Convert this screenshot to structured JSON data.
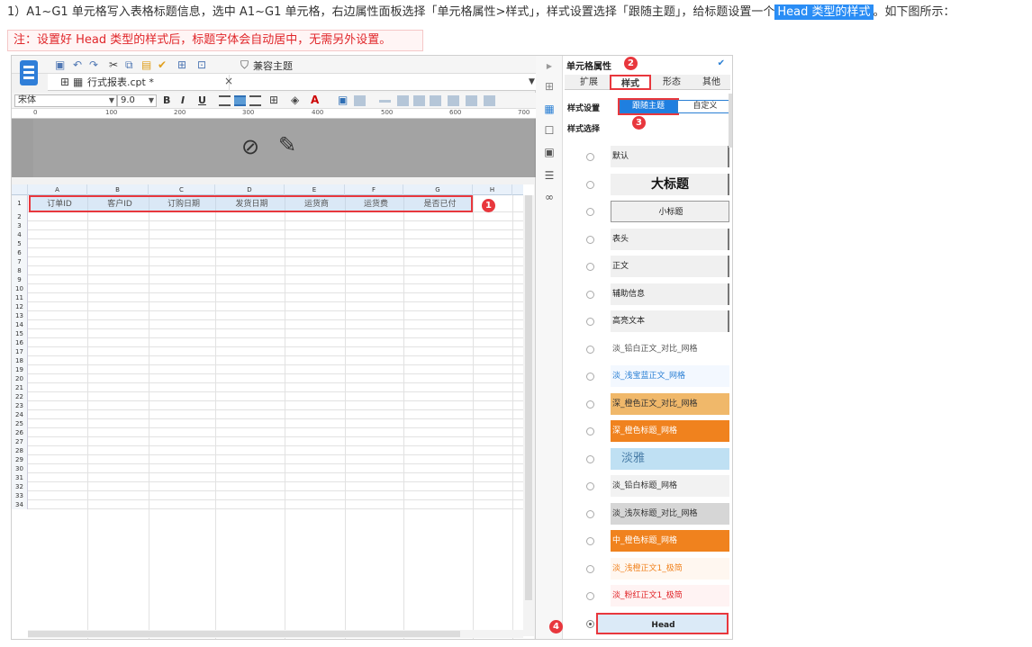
{
  "intro": {
    "text_before": "1）A1~G1 单元格写入表格标题信息，选中 A1~G1 单元格，右边属性面板选择「单元格属性>样式」，样式设置选择「跟随主题」，给标题设置一个",
    "highlight": "Head 类型的样式",
    "text_after": "。如下图所示："
  },
  "note": "注：设置好 Head 类型的样式后，标题字体会自动居中，无需另外设置。",
  "toolbar": {
    "compat_label": "兼容主题",
    "tab_label": "行式报表.cpt *",
    "tab_close": "×",
    "font_name": "宋体",
    "font_size": "9.0",
    "bold": "B",
    "italic": "I",
    "underline": "U"
  },
  "ruler": [
    "0",
    "100",
    "200",
    "300",
    "400",
    "500",
    "600",
    "700"
  ],
  "sheet": {
    "columns": [
      "A",
      "B",
      "C",
      "D",
      "E",
      "F",
      "G",
      "H"
    ],
    "rows": [
      "1",
      "2",
      "3",
      "4",
      "5",
      "6",
      "7",
      "8",
      "9",
      "10",
      "11",
      "12",
      "13",
      "14",
      "15",
      "16",
      "17",
      "18",
      "19",
      "20",
      "21",
      "22",
      "23",
      "24",
      "25",
      "26",
      "27",
      "28",
      "29",
      "30",
      "31",
      "32",
      "33",
      "34"
    ],
    "headers": [
      "订单ID",
      "客户ID",
      "订购日期",
      "发货日期",
      "运货商",
      "运货费",
      "是否已付"
    ]
  },
  "panel": {
    "title": "单元格属性",
    "tabs": [
      "扩展",
      "样式",
      "形态",
      "其他"
    ],
    "style_setting_label": "样式设置",
    "follow_theme": "跟随主题",
    "custom": "自定义",
    "style_select_label": "样式选择",
    "styles": [
      {
        "name": "默认",
        "bg": "#f0f0f0",
        "fg": "#222"
      },
      {
        "name": "大标题",
        "bg": "#f0f0f0",
        "fg": "#111"
      },
      {
        "name": "小标题",
        "bg": "#f0f0f0",
        "fg": "#222"
      },
      {
        "name": "表头",
        "bg": "#f0f0f0",
        "fg": "#222"
      },
      {
        "name": "正文",
        "bg": "#f0f0f0",
        "fg": "#222"
      },
      {
        "name": "辅助信息",
        "bg": "#f0f0f0",
        "fg": "#222"
      },
      {
        "name": "高亮文本",
        "bg": "#f0f0f0",
        "fg": "#222"
      },
      {
        "name": "淡_铅白正文_对比_网格",
        "bg": "#ffffff",
        "fg": "#555"
      },
      {
        "name": "淡_浅宝蓝正文_网格",
        "bg": "#f3f8ff",
        "fg": "#2a7fd4"
      },
      {
        "name": "深_橙色正文_对比_网格",
        "bg": "#f0b86a",
        "fg": "#333"
      },
      {
        "name": "深_橙色标题_网格",
        "bg": "#f0821e",
        "fg": "#fff"
      },
      {
        "name": "淡雅",
        "bg": "#bfe0f3",
        "fg": "#4a7ea8"
      },
      {
        "name": "淡_铅白标题_网格",
        "bg": "#f2f2f2",
        "fg": "#333"
      },
      {
        "name": "淡_浅灰标题_对比_网格",
        "bg": "#d6d6d6",
        "fg": "#333"
      },
      {
        "name": "中_橙色标题_网格",
        "bg": "#f0821e",
        "fg": "#fff"
      },
      {
        "name": "淡_浅橙正文1_极简",
        "bg": "#fff7f0",
        "fg": "#f0821e"
      },
      {
        "name": "淡_粉红正文1_极简",
        "bg": "#fff3f3",
        "fg": "#e0262a"
      },
      {
        "name": "Head",
        "bg": "#dbeaf7",
        "fg": "#222"
      }
    ]
  },
  "callouts": [
    "1",
    "2",
    "3",
    "4"
  ]
}
